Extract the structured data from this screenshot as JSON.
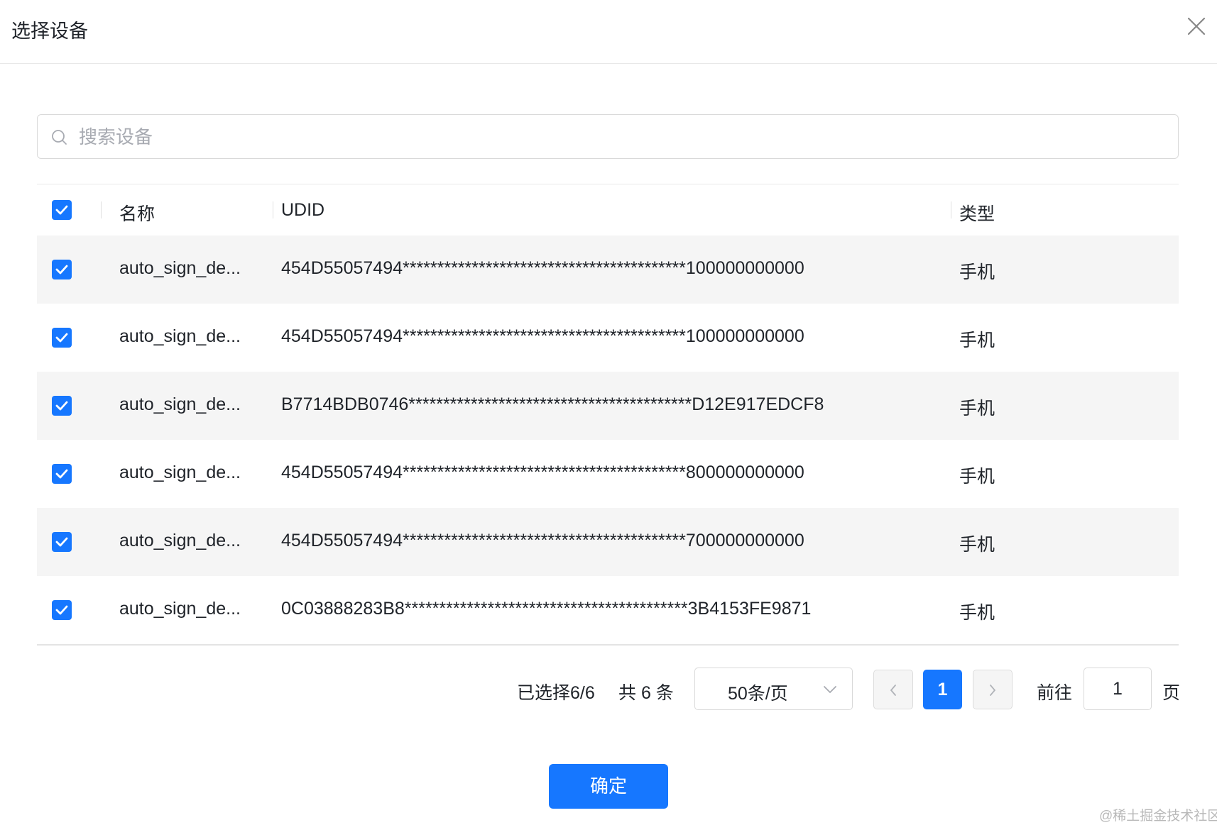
{
  "dialog": {
    "title": "选择设备"
  },
  "search": {
    "placeholder": "搜索设备",
    "value": ""
  },
  "table": {
    "headers": {
      "name": "名称",
      "udid": "UDID",
      "type": "类型"
    },
    "all_selected": true,
    "rows": [
      {
        "name": "auto_sign_de...",
        "udid": "454D55057494*****************************************100000000000",
        "type": "手机",
        "checked": true
      },
      {
        "name": "auto_sign_de...",
        "udid": "454D55057494*****************************************100000000000",
        "type": "手机",
        "checked": true
      },
      {
        "name": "auto_sign_de...",
        "udid": "B7714BDB0746*****************************************D12E917EDCF8",
        "type": "手机",
        "checked": true
      },
      {
        "name": "auto_sign_de...",
        "udid": "454D55057494*****************************************800000000000",
        "type": "手机",
        "checked": true
      },
      {
        "name": "auto_sign_de...",
        "udid": "454D55057494*****************************************700000000000",
        "type": "手机",
        "checked": true
      },
      {
        "name": "auto_sign_de...",
        "udid": "0C03888283B8*****************************************3B4153FE9871",
        "type": "手机",
        "checked": true
      }
    ]
  },
  "pagination": {
    "selected_text": "已选择6/6",
    "total_text": "共 6 条",
    "page_size": "50条/页",
    "current_page": "1",
    "goto_label": "前往",
    "goto_value": "1",
    "page_unit": "页"
  },
  "footer": {
    "confirm_label": "确定"
  },
  "watermark": "@稀土掘金技术社区",
  "colors": {
    "primary": "#1677ff",
    "stripe": "#f5f5f5",
    "border": "#d9d9d9"
  },
  "icons": [
    "close-icon",
    "search-icon",
    "check-icon",
    "chevron-down-icon",
    "chevron-left-icon",
    "chevron-right-icon"
  ]
}
